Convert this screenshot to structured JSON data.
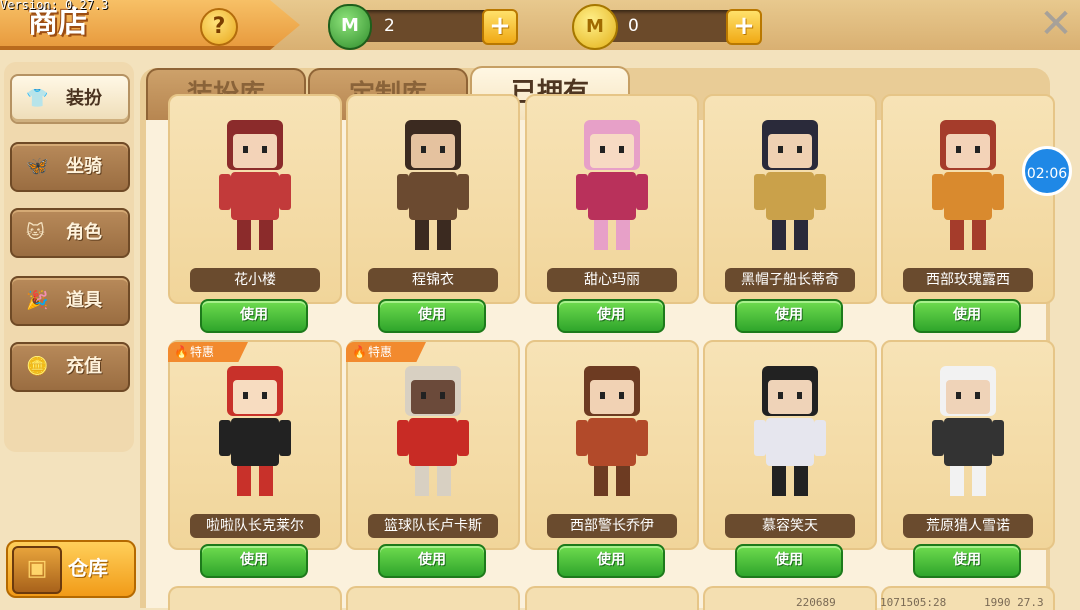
{
  "header": {
    "title": "商店",
    "version": "Version: 0.27.3",
    "help_label": "?",
    "gems": "2",
    "coins": "0",
    "gem_symbol": "M",
    "coin_symbol": "M",
    "plus_label": "+",
    "close_label": "✕"
  },
  "sidebar": {
    "items": [
      {
        "label": "装扮",
        "icon": "shirt-icon",
        "glyph": "👕"
      },
      {
        "label": "坐骑",
        "icon": "mount-icon",
        "glyph": "🦋"
      },
      {
        "label": "角色",
        "icon": "character-icon",
        "glyph": "🐱"
      },
      {
        "label": "道具",
        "icon": "props-icon",
        "glyph": "🎉"
      },
      {
        "label": "充值",
        "icon": "recharge-icon",
        "glyph": "🪙"
      }
    ],
    "warehouse_label": "仓库"
  },
  "tabs": [
    {
      "label": "装扮库"
    },
    {
      "label": "定制库"
    },
    {
      "label": "已拥有"
    }
  ],
  "cards": [
    {
      "name": "花小楼",
      "button": "使用",
      "sale": ""
    },
    {
      "name": "程锦衣",
      "button": "使用",
      "sale": ""
    },
    {
      "name": "甜心玛丽",
      "button": "使用",
      "sale": ""
    },
    {
      "name": "黑帽子船长蒂奇",
      "button": "使用",
      "sale": ""
    },
    {
      "name": "西部玫瑰露西",
      "button": "使用",
      "sale": ""
    },
    {
      "name": "啦啦队长克莱尔",
      "button": "使用",
      "sale": "特惠"
    },
    {
      "name": "篮球队长卢卡斯",
      "button": "使用",
      "sale": "特惠"
    },
    {
      "name": "西部警长乔伊",
      "button": "使用",
      "sale": ""
    },
    {
      "name": "慕容笑天",
      "button": "使用",
      "sale": ""
    },
    {
      "name": "荒原猎人雪诺",
      "button": "使用",
      "sale": ""
    }
  ],
  "timer": "02:06",
  "footer": {
    "left": "220689",
    "mid": "1071505:28",
    "right": "1990 27.3"
  },
  "colors": {
    "accent": "#f0a915",
    "use_button": "#2fa52b",
    "panel": "#e9cc96"
  }
}
